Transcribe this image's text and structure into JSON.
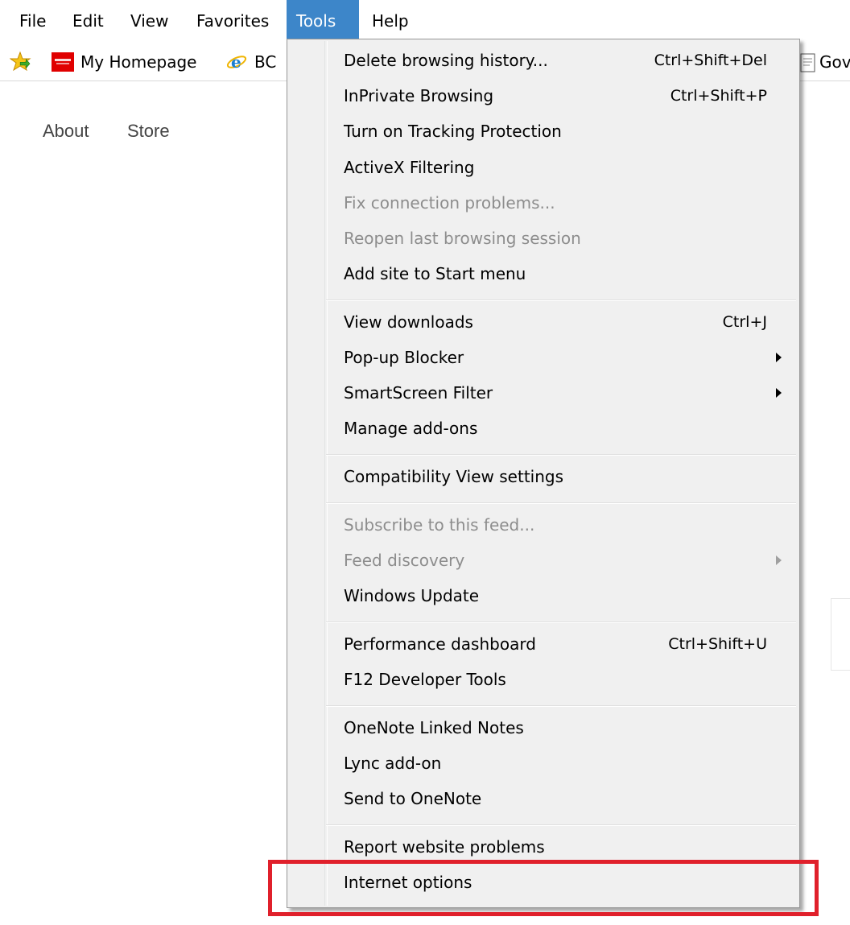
{
  "menubar": {
    "items": [
      "File",
      "Edit",
      "View",
      "Favorites",
      "Tools",
      "Help"
    ],
    "active": "Tools"
  },
  "favorites_bar": {
    "items": [
      {
        "label": "My Homepage",
        "icon": "red-homepage-icon"
      },
      {
        "label": "BC",
        "icon": "ie-logo-icon"
      },
      {
        "label": "Gov",
        "icon": "webpage-icon"
      }
    ],
    "leading_icon": "add-favorites-star-icon"
  },
  "page": {
    "links": [
      "About",
      "Store"
    ]
  },
  "tools_menu": {
    "items": [
      {
        "label": "Delete browsing history...",
        "shortcut": "Ctrl+Shift+Del"
      },
      {
        "label": "InPrivate Browsing",
        "shortcut": "Ctrl+Shift+P"
      },
      {
        "label": "Turn on Tracking Protection"
      },
      {
        "label": "ActiveX Filtering"
      },
      {
        "label": "Fix connection problems...",
        "disabled": true
      },
      {
        "label": "Reopen last browsing session",
        "disabled": true
      },
      {
        "label": "Add site to Start menu"
      },
      {
        "label": "View downloads",
        "shortcut": "Ctrl+J"
      },
      {
        "label": "Pop-up Blocker",
        "submenu": true
      },
      {
        "label": "SmartScreen Filter",
        "submenu": true
      },
      {
        "label": "Manage add-ons"
      },
      {
        "label": "Compatibility View settings"
      },
      {
        "label": "Subscribe to this feed...",
        "disabled": true
      },
      {
        "label": "Feed discovery",
        "disabled": true,
        "submenu": true
      },
      {
        "label": "Windows Update"
      },
      {
        "label": "Performance dashboard",
        "shortcut": "Ctrl+Shift+U"
      },
      {
        "label": "F12 Developer Tools"
      },
      {
        "label": "OneNote Linked Notes"
      },
      {
        "label": "Lync add-on"
      },
      {
        "label": "Send to OneNote"
      },
      {
        "label": "Report website problems"
      },
      {
        "label": "Internet options",
        "highlighted": true
      }
    ]
  },
  "colors": {
    "active_menu_bg": "#3d86c9",
    "highlight_border": "#e0202b",
    "menu_bg": "#f0f0f0",
    "disabled_text": "#8d8d8d"
  }
}
